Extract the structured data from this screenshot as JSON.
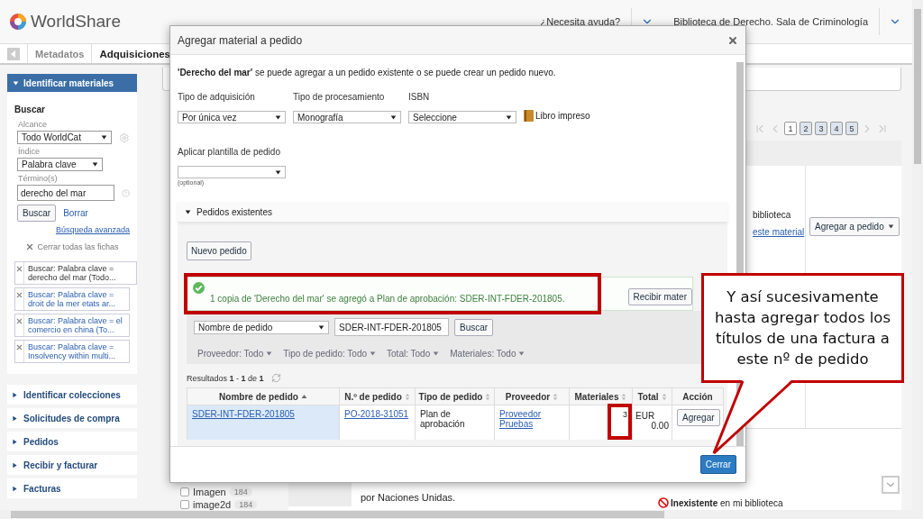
{
  "header": {
    "logo": "WorldShare",
    "help": "¿Necesita ayuda?",
    "library": "Biblioteca de Derecho. Sala de Criminología"
  },
  "tabs": [
    {
      "label": "Metadatos",
      "selected": false
    },
    {
      "label": "Adquisiciones",
      "selected": true
    }
  ],
  "sidebar": {
    "panel": {
      "title": "Identificar materiales",
      "expanded": true
    },
    "search": {
      "heading": "Buscar",
      "scope_label": "Alcance",
      "scope": "Todo WorldCat",
      "index_label": "Índice",
      "index": "Palabra clave",
      "terms_label": "Término(s)",
      "terms": "derecho del mar",
      "search_button": "Buscar",
      "clear_link": "Borrar",
      "advanced_link": "Búsqueda avanzada",
      "close_all": "Cerrar todas las fichas"
    },
    "saved_searches": [
      {
        "text": "Buscar: Palabra clave = derecho del mar (Todo...",
        "selected": true
      },
      {
        "text": "Buscar: Palabra clave = droit de la mer etats ar...",
        "selected": false
      },
      {
        "text": "Buscar: Palabra clave = el comercio en china (To...",
        "selected": false
      },
      {
        "text": "Buscar: Palabra clave = Insolvency within multi...",
        "selected": false
      }
    ],
    "sections": [
      {
        "label": "Identificar colecciones",
        "expanded": false
      },
      {
        "label": "Solicitudes de compra",
        "expanded": false
      },
      {
        "label": "Pedidos",
        "expanded": false
      },
      {
        "label": "Recibir y facturar",
        "expanded": false
      },
      {
        "label": "Facturas",
        "expanded": false
      }
    ]
  },
  "main": {
    "pages": [
      {
        "label": "1",
        "selected": true
      },
      {
        "label": "2",
        "selected": false
      },
      {
        "label": "3",
        "selected": false
      },
      {
        "label": "4",
        "selected": false
      },
      {
        "label": "5",
        "selected": false
      }
    ],
    "first_result": {
      "holding": "biblioteca",
      "link": "este material",
      "button": "Agregar a pedido"
    },
    "facets": [
      {
        "label": "Imagen",
        "count": "184",
        "checked": false
      },
      {
        "label": "image2d",
        "count": "184",
        "checked": false
      }
    ],
    "second_result": {
      "author": "por Naciones Unidas.",
      "holding": "**Inexistente** en mi biblioteca"
    }
  },
  "dialog": {
    "title": "Agregar material a pedido",
    "intro": "**'Derecho del mar'** se puede agregar a un pedido existente o se puede crear un pedido nuevo.",
    "fields": [
      {
        "label": "Tipo de adquisición",
        "value": "Por única vez"
      },
      {
        "label": "Tipo de procesamiento",
        "value": "Monografía"
      },
      {
        "label": "ISBN",
        "value": "Seleccione"
      }
    ],
    "format": "Libro impreso",
    "template": {
      "label": "Aplicar plantilla de pedido",
      "hint": "(optional)"
    },
    "existing": {
      "title": "Pedidos existentes",
      "expanded": true,
      "new_button": "Nuevo pedido",
      "message": "1 copia de 'Derecho del mar' se agregó a Plan de aprobación: SDER-INT-FDER-201805.",
      "receive_button": "Recibir mater",
      "search_by": "Nombre de pedido",
      "query": "SDER-INT-FDER-201805",
      "search_button": "Buscar",
      "filters": [
        "Proveedor: Todo",
        "Tipo de pedido: Todo",
        "Total: Todo",
        "Materiales: Todo"
      ],
      "results_summary": "Resultados **1** - **1** de **1**",
      "columns": [
        {
          "label": "Nombre de pedido",
          "sorted": true
        },
        {
          "label": "N.º de pedido",
          "sorted": false
        },
        {
          "label": "Tipo de pedido",
          "sorted": false
        },
        {
          "label": "Proveedor",
          "sorted": false
        },
        {
          "label": "Materiales",
          "sorted": false
        },
        {
          "label": "Total",
          "sorted": false
        },
        {
          "label": "Acción"
        }
      ],
      "rows": [
        {
          "name": "SDER-INT-FDER-201805",
          "number": "PO-2018-31051",
          "type": "Plan de aprobación",
          "supplier": "Proveedor Pruebas",
          "items": "3",
          "currency": "EUR",
          "amount": "0.00",
          "action": "Agregar"
        }
      ]
    },
    "close_button": "Cerrar"
  },
  "annotation": {
    "text": "Y así sucesivamente hasta agregar todos los títulos de una factura a este nº de pedido"
  }
}
